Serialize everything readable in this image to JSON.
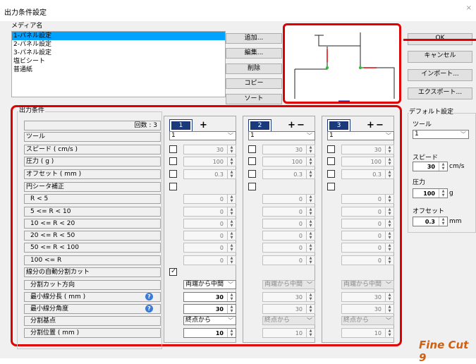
{
  "window": {
    "title": "出力条件設定",
    "close": "×"
  },
  "media": {
    "label": "メディア名",
    "items": [
      "1-パネル設定",
      "2-パネル設定",
      "3-パネル設定",
      "塩ビシート",
      "普通紙"
    ],
    "selected_index": 0
  },
  "media_buttons": {
    "add": "追加...",
    "edit": "編集...",
    "delete": "削除",
    "copy": "コピー",
    "sort": "ソート"
  },
  "dialog_buttons": {
    "ok": "OK",
    "cancel": "キャンセル",
    "import": "インポート...",
    "export": "エクスポート..."
  },
  "output": {
    "group_label": "出力条件",
    "count_label": "回数 : 3",
    "rows": {
      "tool": "ツール",
      "speed": "スピード ( cm/s )",
      "pressure": "圧力 ( g )",
      "offset": "オフセット ( mm )",
      "circle": "円シータ補正",
      "r1": "R < 5",
      "r2": "5 <= R < 10",
      "r3": "10 <= R < 20",
      "r4": "20 <= R < 50",
      "r5": "50 <= R < 100",
      "r6": "100 <= R",
      "auto": "線分の自動分割カット",
      "dir": "分割カット方向",
      "minlen": "最小線分長 ( mm )",
      "minang": "最小線分角度",
      "base": "分割基点",
      "pos": "分割位置 ( mm )"
    },
    "columns": [
      {
        "num": "1",
        "plus": "+",
        "minus": "",
        "tool": "1",
        "speed": "30",
        "pressure": "100",
        "offset": "0.3",
        "r": [
          "0",
          "0",
          "0",
          "0",
          "0",
          "0"
        ],
        "auto_checked": true,
        "dir": "両端から中間",
        "minlen": "30",
        "minang": "30",
        "base": "終点から",
        "pos": "10"
      },
      {
        "num": "2",
        "plus": "+",
        "minus": "−",
        "tool": "1",
        "speed": "30",
        "pressure": "100",
        "offset": "0.3",
        "r": [
          "0",
          "0",
          "0",
          "0",
          "0",
          "0"
        ],
        "auto_checked": false,
        "dir": "両端から中間",
        "minlen": "30",
        "minang": "30",
        "base": "終点から",
        "pos": "10"
      },
      {
        "num": "3",
        "plus": "+",
        "minus": "−",
        "tool": "1",
        "speed": "30",
        "pressure": "100",
        "offset": "0.3",
        "r": [
          "0",
          "0",
          "0",
          "0",
          "0",
          "0"
        ],
        "auto_checked": false,
        "dir": "両端から中間",
        "minlen": "30",
        "minang": "30",
        "base": "終点から",
        "pos": "10"
      }
    ]
  },
  "defaults": {
    "label": "デフォルト設定",
    "tool_label": "ツール",
    "tool_value": "1",
    "speed_label": "スピード",
    "speed_value": "30",
    "speed_unit": "cm/s",
    "pressure_label": "圧力",
    "pressure_value": "100",
    "pressure_unit": "g",
    "offset_label": "オフセット",
    "offset_value": "0.3",
    "offset_unit": "mm"
  },
  "logo": "Fine Cut 9",
  "colors": {
    "accent_red": "#e00000",
    "selection": "#00a2ff",
    "col_header": "#1a3a7c"
  }
}
